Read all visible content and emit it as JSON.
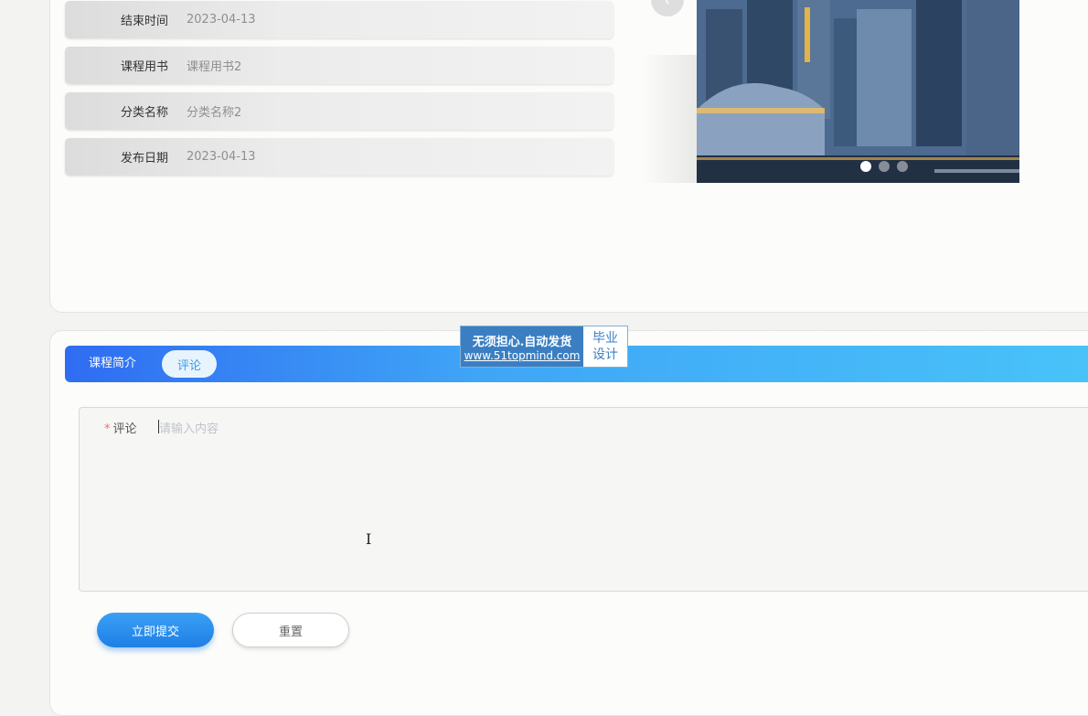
{
  "info": {
    "rows": [
      {
        "label": "结束时间",
        "value": "2023-04-13"
      },
      {
        "label": "课程用书",
        "value": "课程用书2"
      },
      {
        "label": "分类名称",
        "value": "分类名称2"
      },
      {
        "label": "发布日期",
        "value": "2023-04-13"
      }
    ]
  },
  "carousel": {
    "prev_icon": "‹",
    "active_index": 0,
    "slide_count": 3
  },
  "watermark": {
    "line1": "无须担心.自动发货",
    "line2": "www.51topmind.com",
    "right_line1": "毕业",
    "right_line2": "设计"
  },
  "tabs": {
    "intro_label": "课程简介",
    "comment_label": "评论"
  },
  "form": {
    "required_mark": "*",
    "comment_label": "评论",
    "comment_placeholder": "请输入内容",
    "comment_value": ""
  },
  "buttons": {
    "submit_label": "立即提交",
    "reset_label": "重置"
  },
  "colors": {
    "accent": "#3a9be8",
    "tab_gradient_start": "#2f6cf2",
    "tab_gradient_end": "#49c3f9",
    "required": "#f56c6c"
  }
}
